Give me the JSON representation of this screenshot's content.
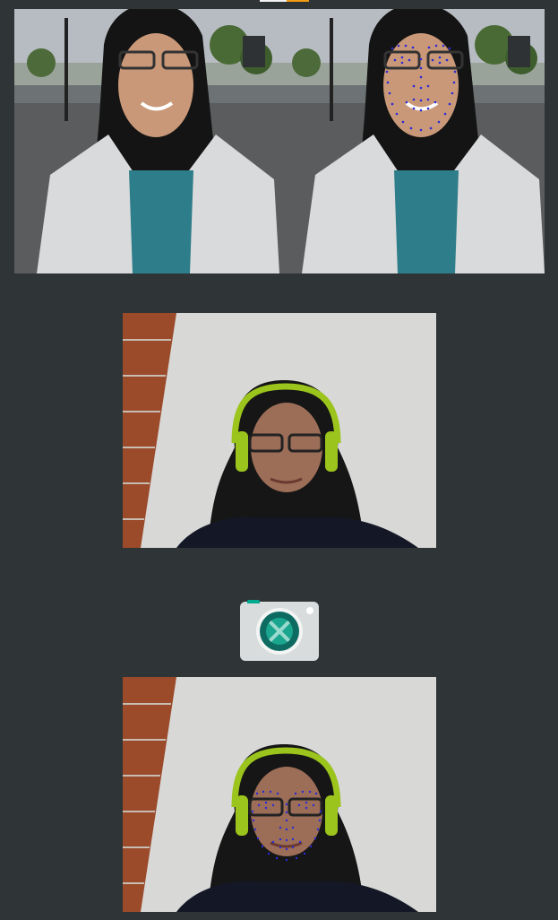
{
  "images": {
    "original_photo": "portrait-outdoors",
    "annotated_photo": "portrait-outdoors-with-face-landmarks",
    "webcam_capture": "webcam-selfie-headphones",
    "webcam_annotated": "webcam-selfie-headphones-with-face-landmarks"
  },
  "camera_button": {
    "icon": "camera-icon"
  },
  "colors": {
    "background": "#2f3437",
    "landmark_dots": "#2a2ad8",
    "accent_orange": "#f39c12",
    "camera_teal": "#1aa58f"
  }
}
